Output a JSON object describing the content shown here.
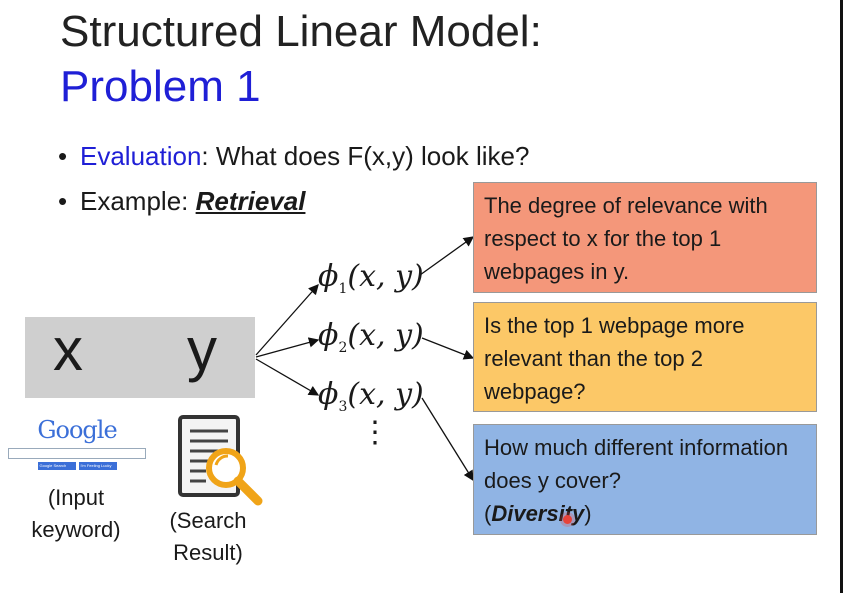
{
  "title": {
    "line1": "Structured Linear Model:",
    "line2": "Problem 1"
  },
  "bullets": {
    "b1_term": "Evaluation",
    "b1_rest": ": What does F(x,y) look like?",
    "b2_prefix": "Example: ",
    "b2_term": "Retrieval"
  },
  "xy": {
    "x": "x",
    "y": "y"
  },
  "features": [
    {
      "phi": "ϕ",
      "sub": "1",
      "args": "(x, y)"
    },
    {
      "phi": "ϕ",
      "sub": "2",
      "args": "(x, y)"
    },
    {
      "phi": "ϕ",
      "sub": "3",
      "args": "(x, y)"
    }
  ],
  "vdots": "⋮",
  "boxes": {
    "box1": "The degree of relevance with respect to x for the top 1 webpages in y.",
    "box2": "Is the top 1 webpage more relevant than the top 2 webpage?",
    "box3_main": "How much different information does y cover?",
    "box3_open": "(",
    "box3_term": "Diversity",
    "box3_close": ")",
    "colors": {
      "box1": "#f4977a",
      "box2": "#fcc867",
      "box3": "#90b4e4"
    }
  },
  "google": {
    "logo": "Google",
    "btn1": "Google Search",
    "btn2": "I'm Feeling Lucky",
    "caption": "(Input keyword)"
  },
  "search_icon": {
    "icon": "magnifier-document-icon",
    "caption": "(Search Result)"
  },
  "colors": {
    "accent_blue": "#1f1fd6"
  }
}
